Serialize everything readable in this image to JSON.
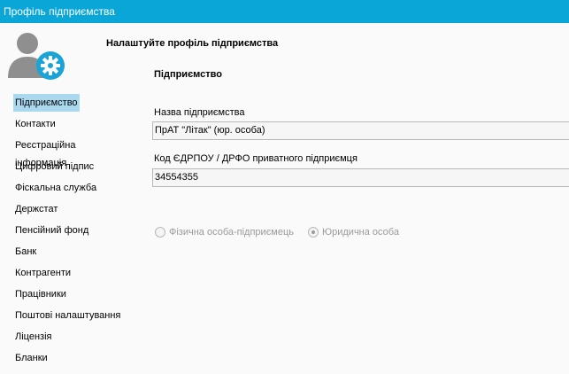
{
  "window": {
    "title": "Профіль підприємства"
  },
  "header": {
    "heading": "Налаштуйте профіль підприємства"
  },
  "section": {
    "title": "Підприємство"
  },
  "sidebar": {
    "items": [
      {
        "label": "Підприємство",
        "active": true
      },
      {
        "label": "Контакти"
      },
      {
        "label": "Реєстраційна інформація"
      },
      {
        "label": "Цифровий підпис"
      },
      {
        "label": "Фіскальна служба"
      },
      {
        "label": "Держстат"
      },
      {
        "label": "Пенсійний фонд"
      },
      {
        "label": "Банк"
      },
      {
        "label": "Контрагенти"
      },
      {
        "label": "Працівники"
      },
      {
        "label": "Поштові налаштування"
      },
      {
        "label": "Ліцензія"
      },
      {
        "label": "Бланки"
      }
    ]
  },
  "form": {
    "name_label": "Назва підприємства",
    "name_value": "ПрАТ \"Літак\" (юр. особа)",
    "code_label": "Код ЄДРПОУ / ДРФО приватного підприємця",
    "code_value": "34554355",
    "radio_individual": "Фізична особа-підприємець",
    "radio_legal": "Юридична особа",
    "selected": "legal"
  },
  "colors": {
    "titlebar": "#0aa6d8",
    "selected_item": "#a9d8ef",
    "gear": "#1aa3d6"
  },
  "icons": {
    "avatar": "user-settings-icon"
  }
}
